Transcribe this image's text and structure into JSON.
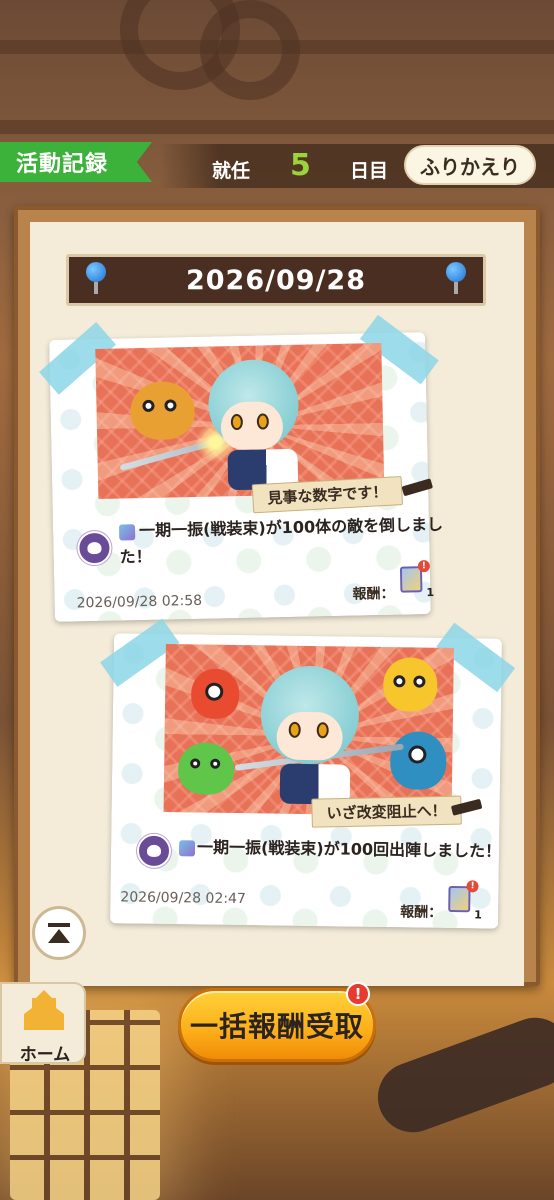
{
  "header": {
    "title": "活動記録",
    "duty_prefix": "就任",
    "duty_days": "5",
    "duty_suffix": "日目",
    "review_button": "ふりかえり"
  },
  "board": {
    "date": "2026/09/28",
    "records": [
      {
        "caption": "見事な数字です！",
        "message_line1": "一期一振(戦装束)が100体の敵を倒しまし",
        "message_line2": "た！",
        "timestamp": "2026/09/28 02:58",
        "reward_label": "報酬：",
        "reward_qty": "1",
        "reward_alert": "!"
      },
      {
        "caption": "いざ改変阻止へ！",
        "message_line1": "一期一振(戦装束)が100回出陣しました！",
        "timestamp": "2026/09/28 02:47",
        "reward_label": "報酬：",
        "reward_qty": "1",
        "reward_alert": "!"
      }
    ]
  },
  "footer": {
    "home_label": "ホーム",
    "claim_all_button": "一括報酬受取",
    "claim_alert": "!"
  },
  "colors": {
    "accent_green": "#3db23a",
    "duty_number": "#9ad33a",
    "claim_button": "#fcae18",
    "alert": "#e63b2e"
  },
  "icons": [
    "scroll-to-top-icon",
    "castle-home-icon",
    "reward-item-icon",
    "character-avatar-icon",
    "equipment-icon",
    "pushpin-icon"
  ]
}
